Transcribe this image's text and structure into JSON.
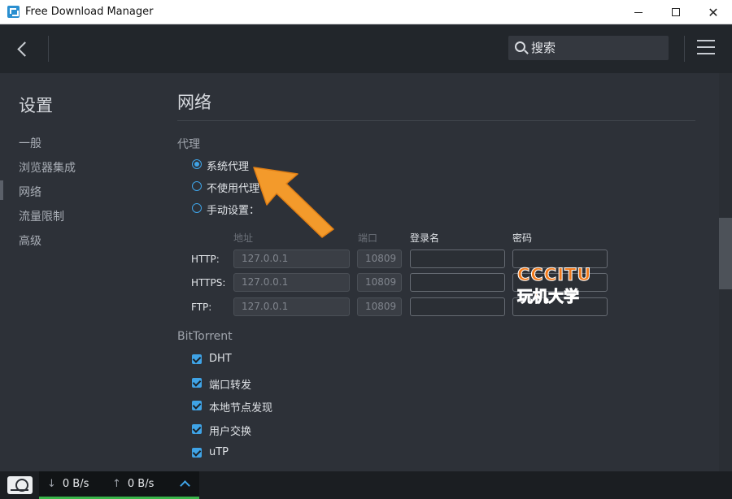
{
  "window": {
    "title": "Free Download Manager",
    "close_glyph": "✕"
  },
  "toolbar": {
    "search_placeholder": "搜索"
  },
  "sidebar": {
    "title": "设置",
    "items": [
      {
        "label": "一般"
      },
      {
        "label": "浏览器集成"
      },
      {
        "label": "网络"
      },
      {
        "label": "流量限制"
      },
      {
        "label": "高级"
      }
    ],
    "active_index": 2
  },
  "main": {
    "title": "网络",
    "proxy": {
      "section_label": "代理",
      "options": [
        {
          "label": "系统代理",
          "checked": true
        },
        {
          "label": "不使用代理",
          "checked": false
        },
        {
          "label": "手动设置：",
          "checked": false
        }
      ],
      "columns": {
        "address": "地址",
        "port": "端口",
        "username": "登录名",
        "password": "密码"
      },
      "rows": [
        {
          "label": "HTTP:",
          "address": "127.0.0.1",
          "port": "10809",
          "username": "",
          "password": ""
        },
        {
          "label": "HTTPS:",
          "address": "127.0.0.1",
          "port": "10809",
          "username": "",
          "password": ""
        },
        {
          "label": "FTP:",
          "address": "127.0.0.1",
          "port": "10809",
          "username": "",
          "password": ""
        }
      ]
    },
    "bittorrent": {
      "section_label": "BitTorrent",
      "options": [
        {
          "label": "DHT",
          "checked": true
        },
        {
          "label": "端口转发",
          "checked": true
        },
        {
          "label": "本地节点发现",
          "checked": true
        },
        {
          "label": "用户交换",
          "checked": true
        },
        {
          "label": "uTP",
          "checked": true
        }
      ]
    }
  },
  "watermark": {
    "line1": "CCCITU",
    "line2": "玩机大学"
  },
  "statusbar": {
    "download_arrow": "↓",
    "download_speed": "0 B/s",
    "upload_arrow": "↑",
    "upload_speed": "0 B/s"
  },
  "colors": {
    "accent": "#3fa3e6",
    "annotation_arrow": "#f39a2b",
    "speed_bar": "#39b54a"
  }
}
